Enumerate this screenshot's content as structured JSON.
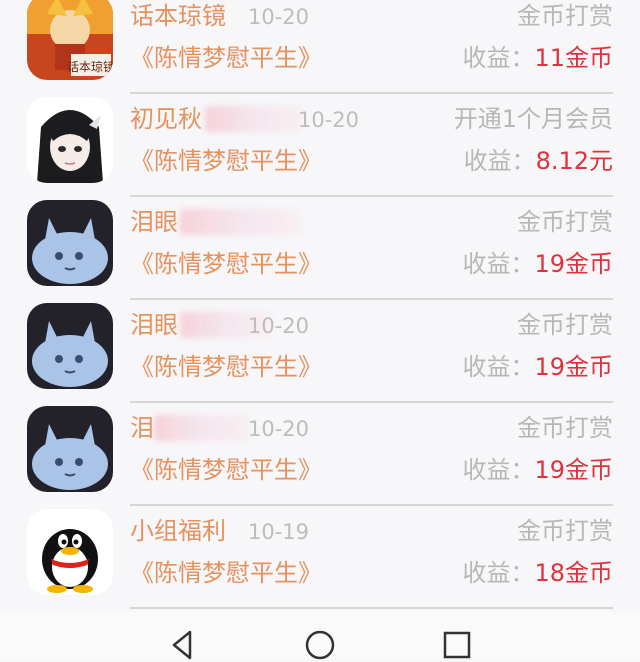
{
  "rows": [
    {
      "avatar": "fox-novel-cover",
      "name": "话本琼镜",
      "date": "10-20",
      "type": "金币打赏",
      "book": "《陈情梦慰平生》",
      "income_label": "收益：",
      "income_value": "11金币",
      "blurred": false
    },
    {
      "avatar": "anime-boy",
      "name": "初见秋",
      "date": "10-20",
      "type": "开通1个月会员",
      "book": "《陈情梦慰平生》",
      "income_label": "收益：",
      "income_value": "8.12元",
      "blurred": true
    },
    {
      "avatar": "blue-blob",
      "name": "泪眼",
      "date": "",
      "type": "金币打赏",
      "book": "《陈情梦慰平生》",
      "income_label": "收益：",
      "income_value": "19金币",
      "blurred": true
    },
    {
      "avatar": "blue-blob",
      "name": "泪眼",
      "date": "10-20",
      "type": "金币打赏",
      "book": "《陈情梦慰平生》",
      "income_label": "收益：",
      "income_value": "19金币",
      "blurred": true
    },
    {
      "avatar": "blue-blob",
      "name": "泪",
      "date": "10-20",
      "type": "金币打赏",
      "book": "《陈情梦慰平生》",
      "income_label": "收益：",
      "income_value": "19金币",
      "blurred": true
    },
    {
      "avatar": "qq-penguin",
      "name": "小组福利",
      "date": "10-19",
      "type": "金币打赏",
      "book": "《陈情梦慰平生》",
      "income_label": "收益：",
      "income_value": "18金币",
      "blurred": false
    }
  ],
  "navbar": {
    "icons": [
      "back-triangle-icon",
      "home-circle-icon",
      "recents-square-icon"
    ]
  },
  "colors": {
    "name": "#e5925f",
    "muted": "#b7b7b7",
    "income": "#e0323d",
    "divider": "#d9d4d6"
  }
}
